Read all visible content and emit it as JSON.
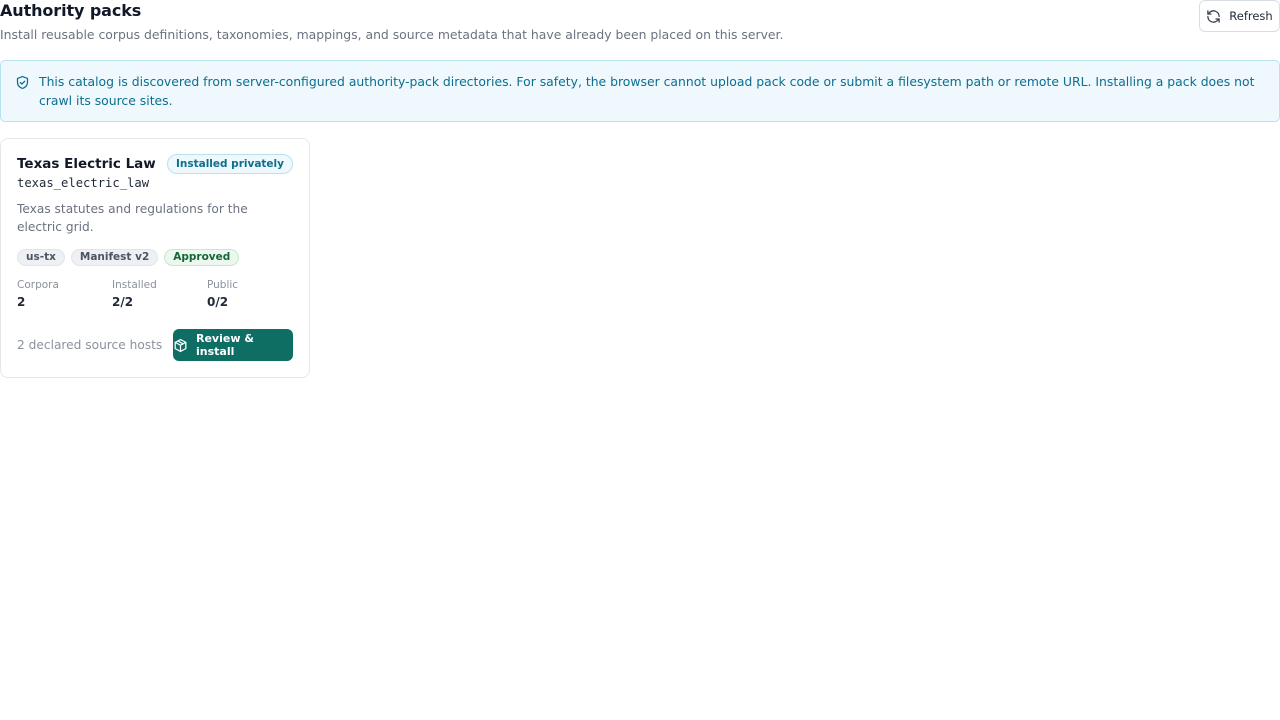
{
  "header": {
    "title": "Authority packs",
    "subtitle": "Install reusable corpus definitions, taxonomies, mappings, and source metadata that have already been placed on this server.",
    "refresh_label": "Refresh",
    "refresh_icon": "refresh-icon"
  },
  "notice": {
    "icon": "shield-check-icon",
    "text": "This catalog is discovered from server-configured authority-pack directories. For safety, the browser cannot upload pack code or submit a filesystem path or remote URL. Installing a pack does not crawl its source sites."
  },
  "packs": [
    {
      "name": "Texas Electric Law",
      "id": "texas_electric_law",
      "status": "Installed privately",
      "description": "Texas statutes and regulations for the electric grid.",
      "tags": [
        {
          "label": "us-tx",
          "kind": "neutral"
        },
        {
          "label": "Manifest v2",
          "kind": "neutral"
        },
        {
          "label": "Approved",
          "kind": "success"
        }
      ],
      "stats": [
        {
          "label": "Corpora",
          "value": "2"
        },
        {
          "label": "Installed",
          "value": "2/2"
        },
        {
          "label": "Public",
          "value": "0/2"
        }
      ],
      "hosts": "2 declared source hosts",
      "install_label": "Review & install",
      "install_icon": "package-icon"
    }
  ],
  "colors": {
    "accent": "#0f6e64",
    "info": "#0d6e8e",
    "info_bg": "#eef8fd",
    "success": "#166534"
  }
}
